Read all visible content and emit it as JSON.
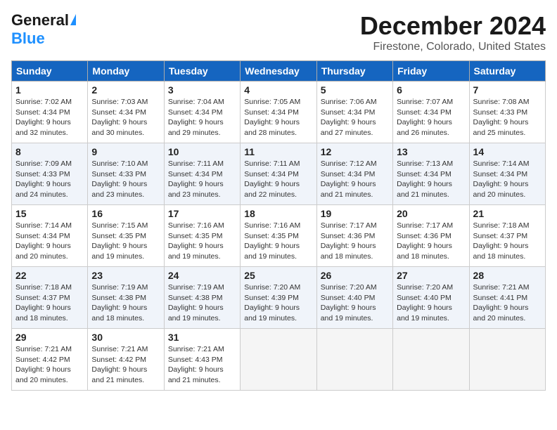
{
  "header": {
    "logo_line1": "General",
    "logo_line2": "Blue",
    "month_title": "December 2024",
    "location": "Firestone, Colorado, United States"
  },
  "days_of_week": [
    "Sunday",
    "Monday",
    "Tuesday",
    "Wednesday",
    "Thursday",
    "Friday",
    "Saturday"
  ],
  "weeks": [
    [
      {
        "day": "1",
        "sunrise": "7:02 AM",
        "sunset": "4:34 PM",
        "daylight": "9 hours and 32 minutes."
      },
      {
        "day": "2",
        "sunrise": "7:03 AM",
        "sunset": "4:34 PM",
        "daylight": "9 hours and 30 minutes."
      },
      {
        "day": "3",
        "sunrise": "7:04 AM",
        "sunset": "4:34 PM",
        "daylight": "9 hours and 29 minutes."
      },
      {
        "day": "4",
        "sunrise": "7:05 AM",
        "sunset": "4:34 PM",
        "daylight": "9 hours and 28 minutes."
      },
      {
        "day": "5",
        "sunrise": "7:06 AM",
        "sunset": "4:34 PM",
        "daylight": "9 hours and 27 minutes."
      },
      {
        "day": "6",
        "sunrise": "7:07 AM",
        "sunset": "4:34 PM",
        "daylight": "9 hours and 26 minutes."
      },
      {
        "day": "7",
        "sunrise": "7:08 AM",
        "sunset": "4:33 PM",
        "daylight": "9 hours and 25 minutes."
      }
    ],
    [
      {
        "day": "8",
        "sunrise": "7:09 AM",
        "sunset": "4:33 PM",
        "daylight": "9 hours and 24 minutes."
      },
      {
        "day": "9",
        "sunrise": "7:10 AM",
        "sunset": "4:33 PM",
        "daylight": "9 hours and 23 minutes."
      },
      {
        "day": "10",
        "sunrise": "7:11 AM",
        "sunset": "4:34 PM",
        "daylight": "9 hours and 23 minutes."
      },
      {
        "day": "11",
        "sunrise": "7:11 AM",
        "sunset": "4:34 PM",
        "daylight": "9 hours and 22 minutes."
      },
      {
        "day": "12",
        "sunrise": "7:12 AM",
        "sunset": "4:34 PM",
        "daylight": "9 hours and 21 minutes."
      },
      {
        "day": "13",
        "sunrise": "7:13 AM",
        "sunset": "4:34 PM",
        "daylight": "9 hours and 21 minutes."
      },
      {
        "day": "14",
        "sunrise": "7:14 AM",
        "sunset": "4:34 PM",
        "daylight": "9 hours and 20 minutes."
      }
    ],
    [
      {
        "day": "15",
        "sunrise": "7:14 AM",
        "sunset": "4:34 PM",
        "daylight": "9 hours and 20 minutes."
      },
      {
        "day": "16",
        "sunrise": "7:15 AM",
        "sunset": "4:35 PM",
        "daylight": "9 hours and 19 minutes."
      },
      {
        "day": "17",
        "sunrise": "7:16 AM",
        "sunset": "4:35 PM",
        "daylight": "9 hours and 19 minutes."
      },
      {
        "day": "18",
        "sunrise": "7:16 AM",
        "sunset": "4:35 PM",
        "daylight": "9 hours and 19 minutes."
      },
      {
        "day": "19",
        "sunrise": "7:17 AM",
        "sunset": "4:36 PM",
        "daylight": "9 hours and 18 minutes."
      },
      {
        "day": "20",
        "sunrise": "7:17 AM",
        "sunset": "4:36 PM",
        "daylight": "9 hours and 18 minutes."
      },
      {
        "day": "21",
        "sunrise": "7:18 AM",
        "sunset": "4:37 PM",
        "daylight": "9 hours and 18 minutes."
      }
    ],
    [
      {
        "day": "22",
        "sunrise": "7:18 AM",
        "sunset": "4:37 PM",
        "daylight": "9 hours and 18 minutes."
      },
      {
        "day": "23",
        "sunrise": "7:19 AM",
        "sunset": "4:38 PM",
        "daylight": "9 hours and 18 minutes."
      },
      {
        "day": "24",
        "sunrise": "7:19 AM",
        "sunset": "4:38 PM",
        "daylight": "9 hours and 19 minutes."
      },
      {
        "day": "25",
        "sunrise": "7:20 AM",
        "sunset": "4:39 PM",
        "daylight": "9 hours and 19 minutes."
      },
      {
        "day": "26",
        "sunrise": "7:20 AM",
        "sunset": "4:40 PM",
        "daylight": "9 hours and 19 minutes."
      },
      {
        "day": "27",
        "sunrise": "7:20 AM",
        "sunset": "4:40 PM",
        "daylight": "9 hours and 19 minutes."
      },
      {
        "day": "28",
        "sunrise": "7:21 AM",
        "sunset": "4:41 PM",
        "daylight": "9 hours and 20 minutes."
      }
    ],
    [
      {
        "day": "29",
        "sunrise": "7:21 AM",
        "sunset": "4:42 PM",
        "daylight": "9 hours and 20 minutes."
      },
      {
        "day": "30",
        "sunrise": "7:21 AM",
        "sunset": "4:42 PM",
        "daylight": "9 hours and 21 minutes."
      },
      {
        "day": "31",
        "sunrise": "7:21 AM",
        "sunset": "4:43 PM",
        "daylight": "9 hours and 21 minutes."
      },
      null,
      null,
      null,
      null
    ]
  ],
  "labels": {
    "sunrise": "Sunrise:",
    "sunset": "Sunset:",
    "daylight": "Daylight:"
  }
}
